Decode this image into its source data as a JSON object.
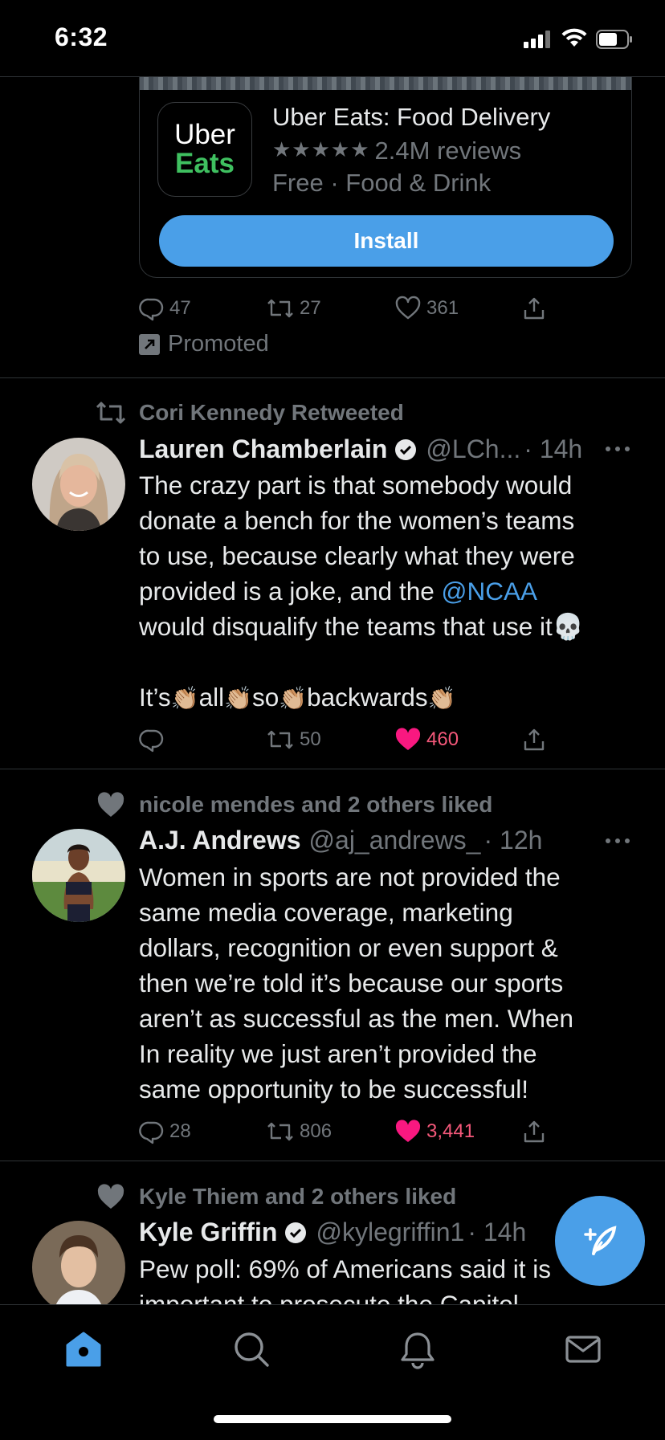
{
  "status_bar": {
    "time": "6:32"
  },
  "ad": {
    "app_logo_line1": "Uber",
    "app_logo_line2": "Eats",
    "app_name": "Uber Eats: Food Delivery",
    "stars": "★★★★★",
    "reviews": "2.4M reviews",
    "meta": "Free · Food & Drink",
    "install_label": "Install",
    "replies": "47",
    "retweets": "27",
    "likes": "361",
    "promoted_label": "Promoted"
  },
  "tweets": [
    {
      "context": "Cori Kennedy Retweeted",
      "name": "Lauren Chamberlain",
      "handle": "@LCh...",
      "time": "· 14h",
      "body_lines": [
        "The crazy part is that somebody would",
        "donate a bench for the women’s teams",
        "to use, because clearly what they were",
        "provided is a joke, and the "
      ],
      "mention": "@NCAA",
      "body_line_after": "would disqualify the teams that use it",
      "skull": "💀",
      "body_line_2_parts": [
        "It’s",
        "all",
        "so",
        "backwards"
      ],
      "clap": "👏🏼",
      "replies": "",
      "retweets": "50",
      "likes": "460"
    },
    {
      "context": "nicole mendes and 2 others liked",
      "name": "A.J. Andrews",
      "handle": "@aj_andrews_",
      "time": "· 12h",
      "body_lines": [
        "Women in sports are not provided the",
        "same media coverage, marketing",
        "dollars, recognition or even support &",
        "then we’re told it’s because our sports",
        "aren’t as successful as the men. When",
        "In reality we just aren’t provided the",
        "same opportunity to be successful!"
      ],
      "replies": "28",
      "retweets": "806",
      "likes": "3,441"
    },
    {
      "context": "Kyle Thiem and 2 others liked",
      "name": "Kyle Griffin",
      "handle": "@kylegriffin1",
      "time": "· 14h",
      "body_lines": [
        "Pew poll: 69% of Americans said it is",
        "important to prosecute the Capitol"
      ]
    }
  ],
  "colors": {
    "accent": "#4a9fe8",
    "like": "#f91880",
    "muted": "#71767b",
    "background": "#000000"
  },
  "bottom_nav": {
    "items": [
      "home-icon",
      "search-icon",
      "notifications-icon",
      "messages-icon"
    ],
    "active": "home-icon"
  }
}
